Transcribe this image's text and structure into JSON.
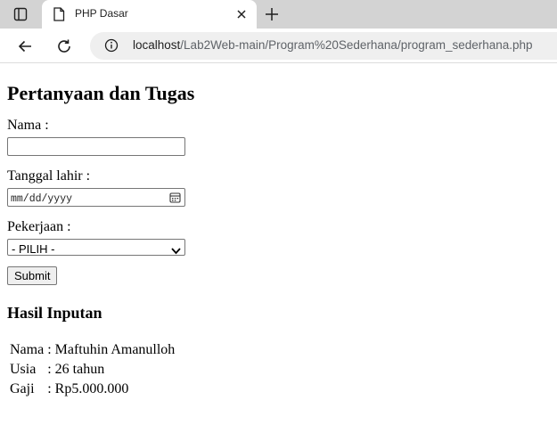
{
  "browser": {
    "tab_title": "PHP Dasar",
    "url_host": "localhost",
    "url_path": "/Lab2Web-main/Program%20Sederhana/program_sederhana.php"
  },
  "page": {
    "heading": "Pertanyaan dan Tugas",
    "form": {
      "name_label": "Nama :",
      "name_value": "",
      "dob_label": "Tanggal lahir :",
      "dob_placeholder": "mm/dd/yyyy",
      "job_label": "Pekerjaan :",
      "job_selected": "- PILIH -",
      "submit_label": "Submit"
    },
    "results": {
      "heading": "Hasil Inputan",
      "rows": [
        {
          "label": "Nama",
          "value": ": Maftuhin Amanulloh"
        },
        {
          "label": "Usia",
          "value": ": 26 tahun"
        },
        {
          "label": "Gaji",
          "value": ": Rp5.000.000"
        }
      ]
    }
  }
}
